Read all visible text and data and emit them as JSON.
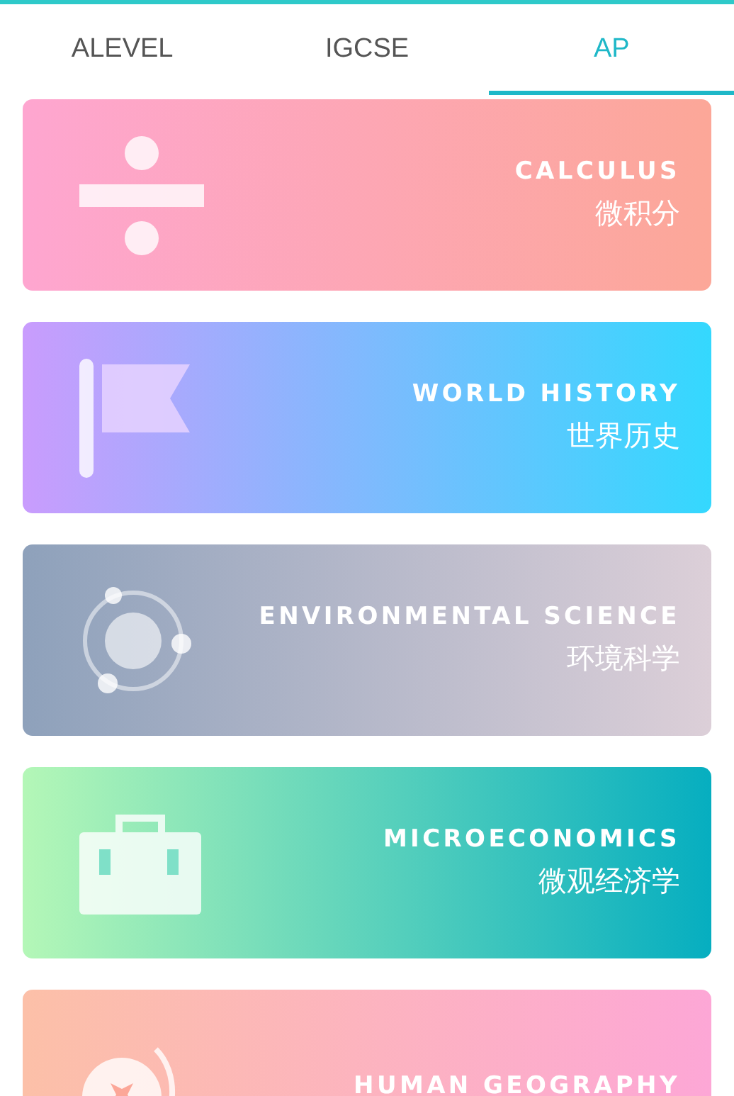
{
  "tabs": [
    {
      "label": "ALEVEL",
      "selected": false
    },
    {
      "label": "IGCSE",
      "selected": false
    },
    {
      "label": "AP",
      "selected": true
    }
  ],
  "courses": [
    {
      "kind": "divide",
      "title": "CALCULUS",
      "subtitle": "微积分"
    },
    {
      "kind": "flag",
      "title": "WORLD HISTORY",
      "subtitle": "世界历史"
    },
    {
      "kind": "orbit",
      "title": "ENVIRONMENTAL SCIENCE",
      "subtitle": "环境科学"
    },
    {
      "kind": "toolbox",
      "title": "MICROECONOMICS",
      "subtitle": "微观经济学"
    },
    {
      "kind": "globe",
      "title": "HUMAN GEOGRAPHY"
    }
  ]
}
